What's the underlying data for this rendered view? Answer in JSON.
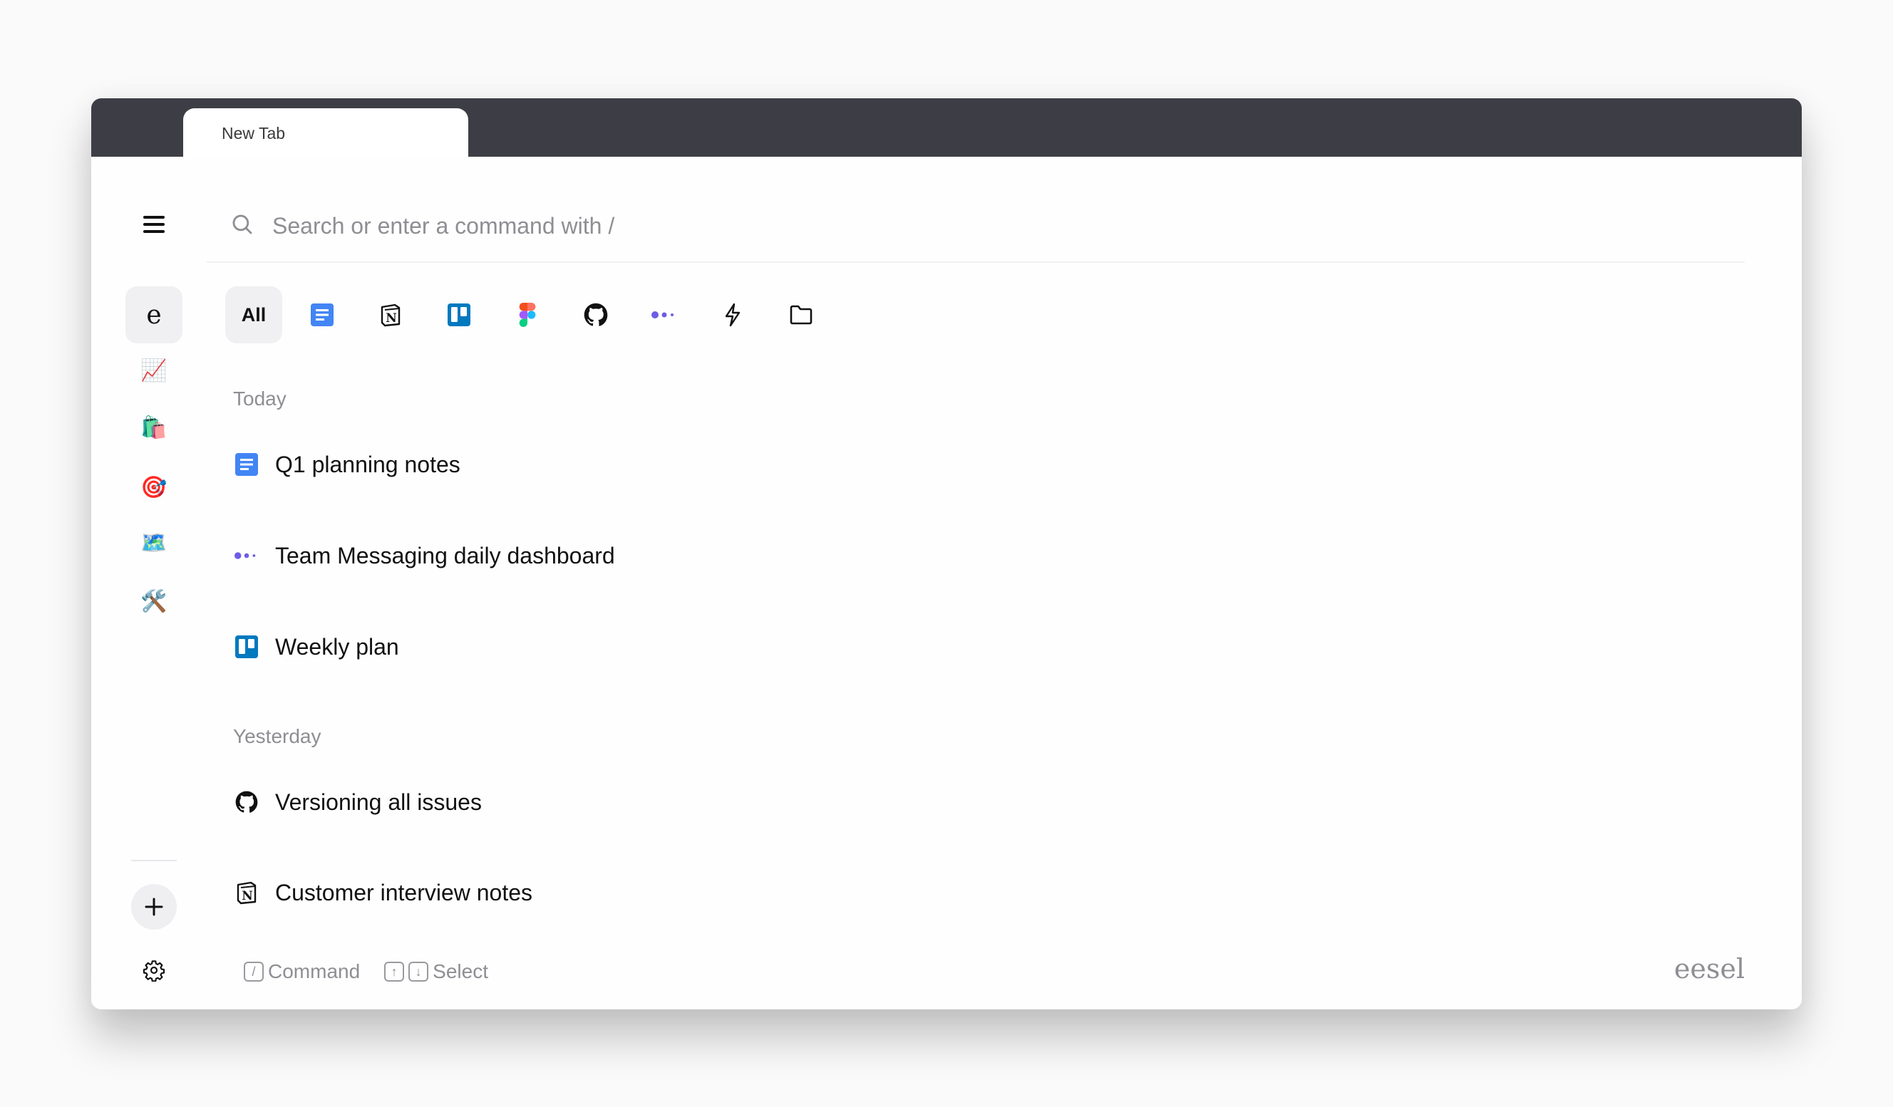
{
  "browser": {
    "tab_title": "New Tab"
  },
  "search": {
    "placeholder": "Search or enter a command with /",
    "value": ""
  },
  "sidebar": {
    "workspace_letter": "e",
    "workspaces": [
      {
        "name": "chart-increasing-emoji",
        "glyph": "📈"
      },
      {
        "name": "shopping-bags-emoji",
        "glyph": "🛍️"
      },
      {
        "name": "direct-hit-emoji",
        "glyph": "🎯"
      },
      {
        "name": "world-map-emoji",
        "glyph": "🗺️"
      },
      {
        "name": "hammer-and-wrench-emoji",
        "glyph": "🛠️"
      }
    ],
    "add_label": "+"
  },
  "filters": {
    "all_label": "All",
    "items": [
      "google-docs",
      "notion",
      "trello",
      "figma",
      "github",
      "team-messaging",
      "bolt-actions",
      "folder"
    ]
  },
  "sections": [
    {
      "label": "Today",
      "items": [
        {
          "icon": "google-docs-icon",
          "title": "Q1 planning notes"
        },
        {
          "icon": "team-messaging-icon",
          "title": "Team Messaging daily dashboard"
        },
        {
          "icon": "trello-icon",
          "title": "Weekly plan"
        }
      ]
    },
    {
      "label": "Yesterday",
      "items": [
        {
          "icon": "github-icon",
          "title": "Versioning all issues"
        },
        {
          "icon": "notion-icon",
          "title": "Customer interview notes"
        }
      ]
    }
  ],
  "footer": {
    "command_key": "/",
    "command_label": "Command",
    "up_key": "↑",
    "down_key": "↓",
    "select_label": "Select",
    "brand": "eesel"
  },
  "colors": {
    "topbar": "#3d3e45",
    "google_docs": "#4285f4",
    "trello": "#0079bf",
    "team_messaging": "#6e5ce6",
    "muted_text": "#8e8e93"
  }
}
